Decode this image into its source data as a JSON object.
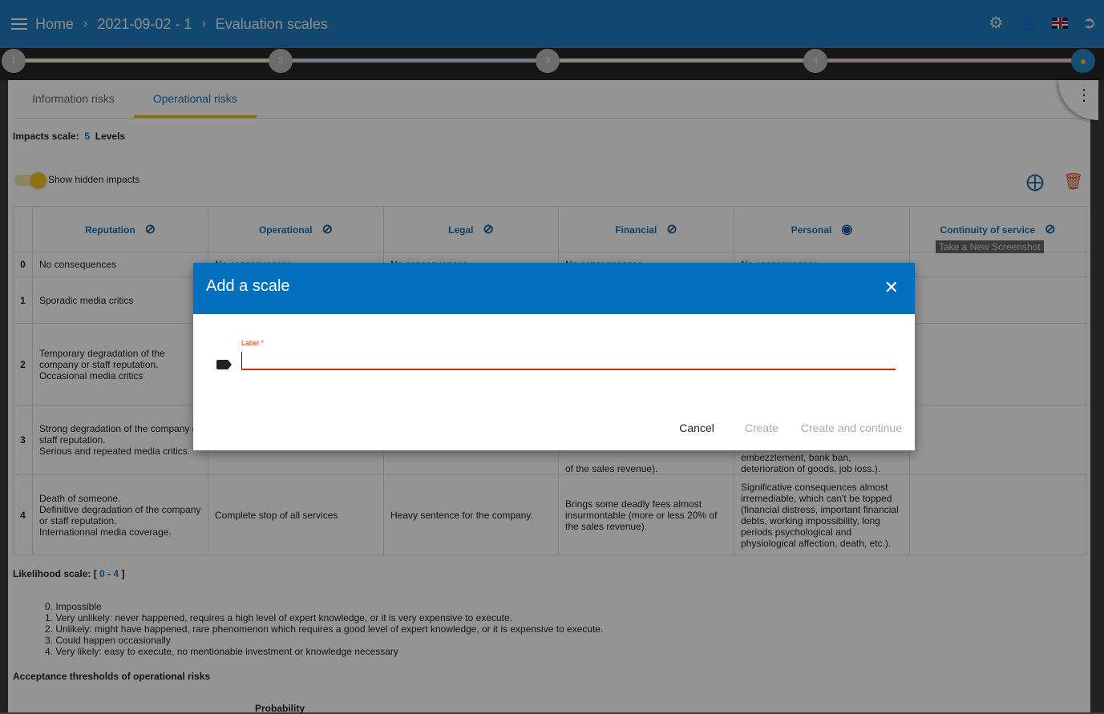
{
  "header": {
    "breadcrumbs": [
      "Home",
      "2021-09-02 - 1",
      "Evaluation scales"
    ],
    "icons": [
      "settings-icon",
      "account-icon",
      "uk-flag-icon",
      "logout-icon"
    ]
  },
  "stepper": {
    "steps": [
      "1",
      "2",
      "3",
      "4"
    ]
  },
  "tabs": [
    {
      "label": "Information risks"
    },
    {
      "label": "Operational risks",
      "active": true
    }
  ],
  "impacts": {
    "label": "Impacts scale:",
    "count": "5",
    "unit": "Levels",
    "toggle_label": "Show hidden impacts",
    "toggle_on": true
  },
  "table": {
    "columns": [
      {
        "label": "Reputation",
        "icon": "eye-off"
      },
      {
        "label": "Operational",
        "icon": "eye-off"
      },
      {
        "label": "Legal",
        "icon": "eye-off"
      },
      {
        "label": "Financial",
        "icon": "eye-off"
      },
      {
        "label": "Personal",
        "icon": "eye"
      },
      {
        "label": "Continuity of service",
        "icon": "eye-off"
      }
    ],
    "rows": [
      {
        "level": "0",
        "cells": [
          "No consequences",
          "No consequences",
          "No consequences",
          "No consequences",
          "No consequences",
          ""
        ]
      },
      {
        "level": "1",
        "cells": [
          "Sporadic media critics",
          "",
          "",
          "",
          "",
          ""
        ]
      },
      {
        "level": "2",
        "cells": [
          "Temporary degradation of the company or staff reputation.\nOccasional media critics",
          "",
          "",
          "",
          "",
          ""
        ]
      },
      {
        "level": "3",
        "cells": [
          "Strong degradation of the company or staff reputation.\nSerious and repeated media critics.",
          "",
          "",
          "of the sales revenue).",
          "embezzlement, bank ban, deterioration of goods, job loss.).",
          ""
        ]
      },
      {
        "level": "4",
        "cells": [
          "Death of someone.\nDefinitive degradation of the company or staff reputation.\nInternationnal media coverage.",
          "Complete stop of all services",
          "Heavy sentence for the company.",
          "Brings some deadly fees almost insurmontable (more or less 20% of the sales revenue).",
          "Significative consequences almost irremediable, which can't be topped (financial distress, important financial debts, working impossibility, long periods psychological and physiological affection, death, etc.).",
          ""
        ]
      }
    ]
  },
  "tooltip": "Take a New Screenshot",
  "likelihood": {
    "label": "Likelihood scale: [",
    "min": "0",
    "dash": "-",
    "max": "4",
    "close": "]",
    "items": [
      "0. Impossible",
      "1. Very unlikely: never happened, requires a high level of expert knowledge, or it is very expensive to execute.",
      "2. Unlikely: might have happened, rare phenomenon which requires a good level of expert knowledge, or it is expensive to execute.",
      "3. Could happen occasionally",
      "4. Very likely: easy to execute, no mentionable investment or knowledge necessary"
    ]
  },
  "thresholds": {
    "title": "Acceptance thresholds of operational risks",
    "probability": "Probability"
  },
  "modal": {
    "title": "Add a scale",
    "field_label": "Label *",
    "field_value": "",
    "cancel": "Cancel",
    "create": "Create",
    "create_continue": "Create and continue"
  },
  "colors": {
    "header": "#1f7cc0",
    "modal_header": "#006fbc",
    "accent": "#e6b325",
    "error": "#d52b00",
    "delete": "#e0552a"
  }
}
